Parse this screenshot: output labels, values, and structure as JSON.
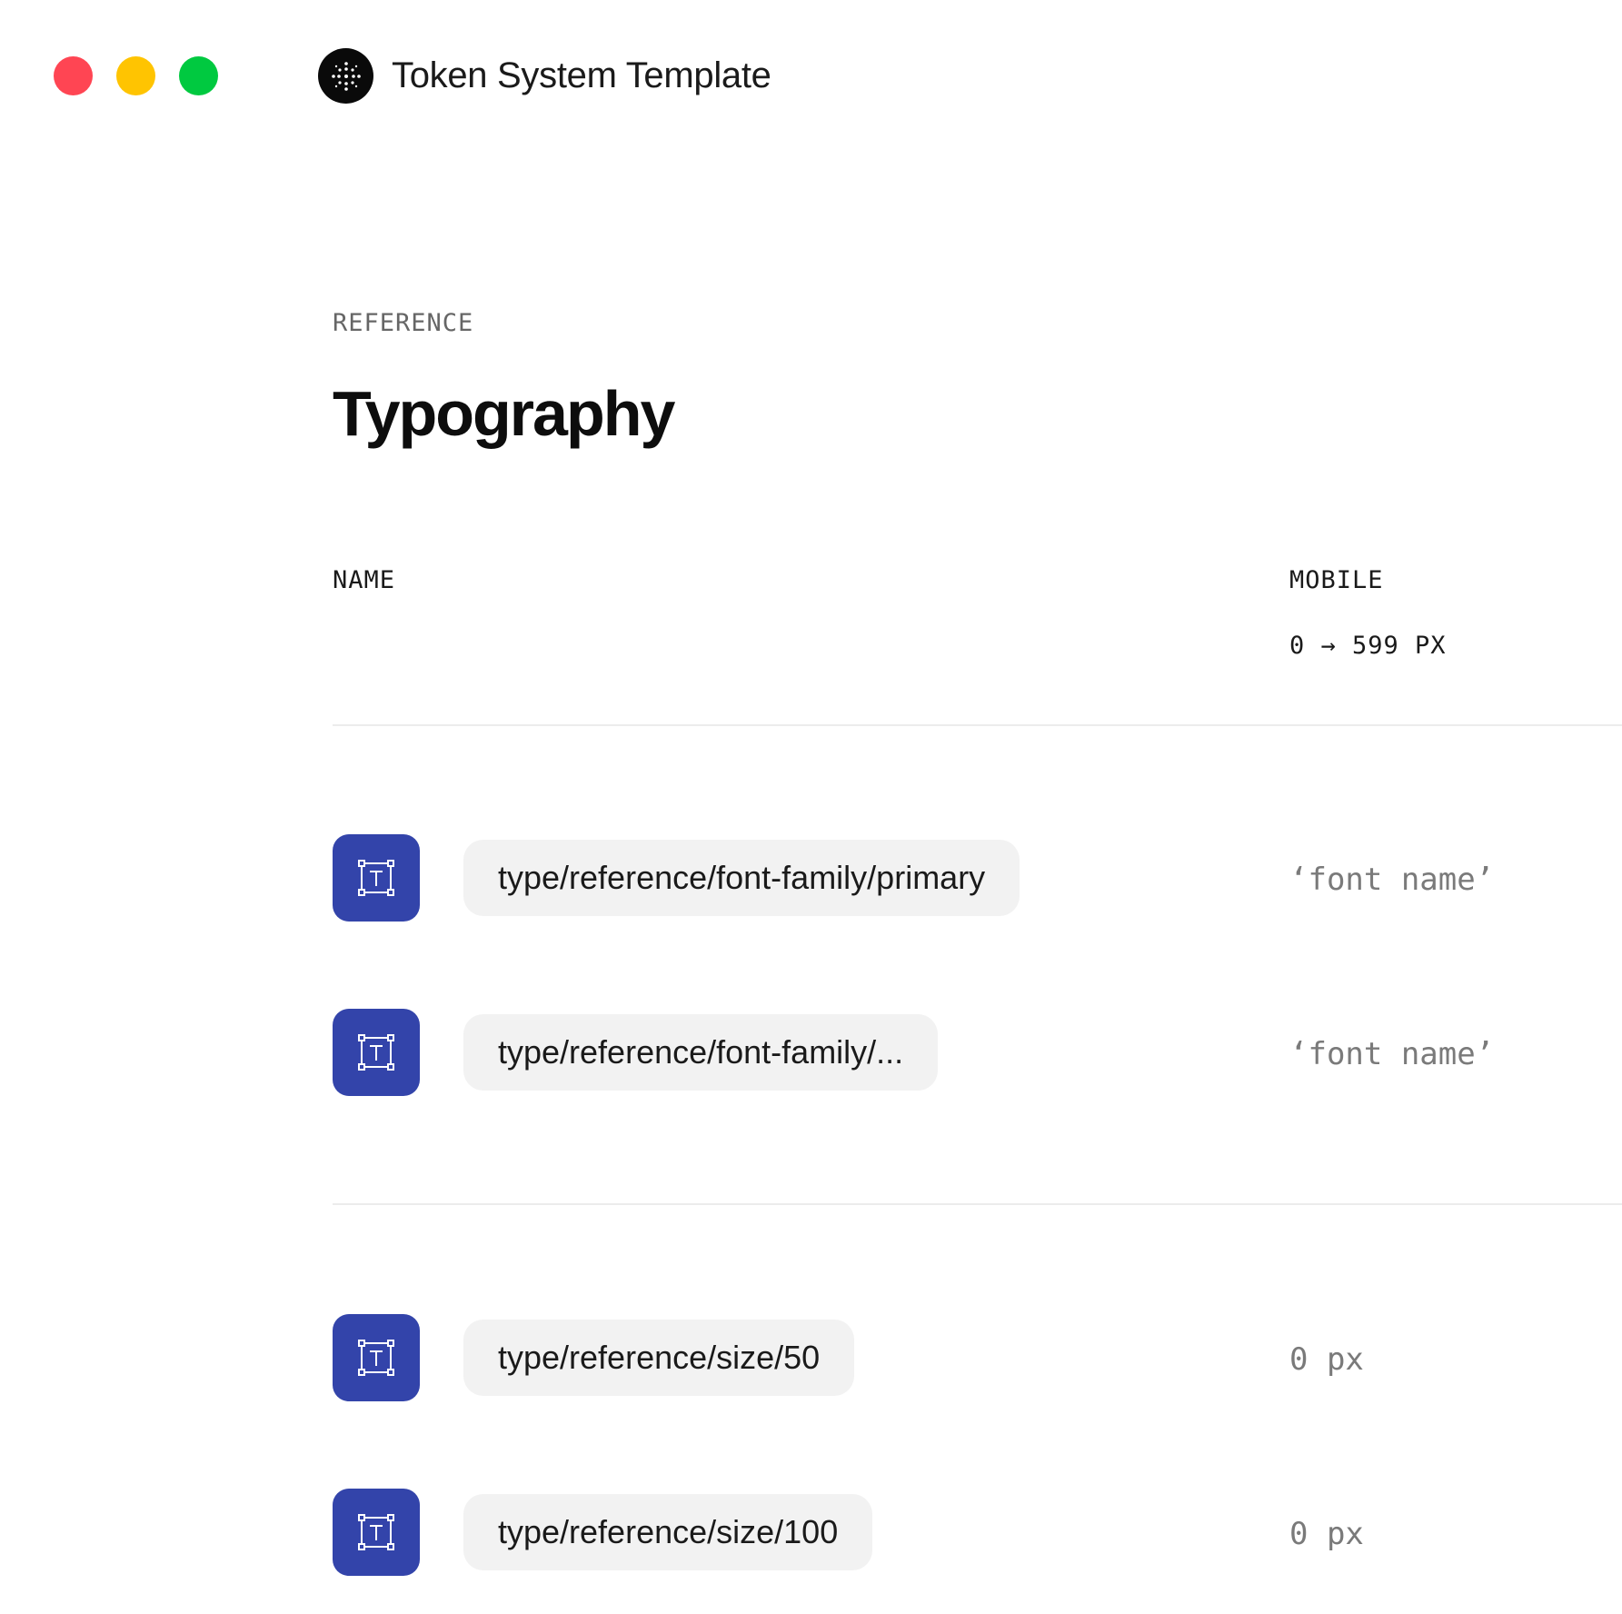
{
  "app": {
    "title": "Token System Template"
  },
  "window_controls": [
    {
      "name": "close",
      "color": "#ff4553"
    },
    {
      "name": "minimize",
      "color": "#ffc401"
    },
    {
      "name": "maximize",
      "color": "#00c940"
    }
  ],
  "page": {
    "eyebrow": "REFERENCE",
    "title": "Typography"
  },
  "table": {
    "columns": {
      "name": "NAME",
      "mobile": "MOBILE",
      "mobile_range": "0 → 599 PX"
    },
    "groups": [
      {
        "rows": [
          {
            "token": "type/reference/font-family/primary",
            "value": "‘font name’"
          },
          {
            "token": "type/reference/font-family/...",
            "value": "‘font name’"
          }
        ]
      },
      {
        "rows": [
          {
            "token": "type/reference/size/50",
            "value": "0 px"
          },
          {
            "token": "type/reference/size/100",
            "value": "0 px"
          }
        ]
      }
    ]
  },
  "colors": {
    "token_icon_bg": "#3344aa",
    "pill_bg": "#f2f2f2"
  }
}
